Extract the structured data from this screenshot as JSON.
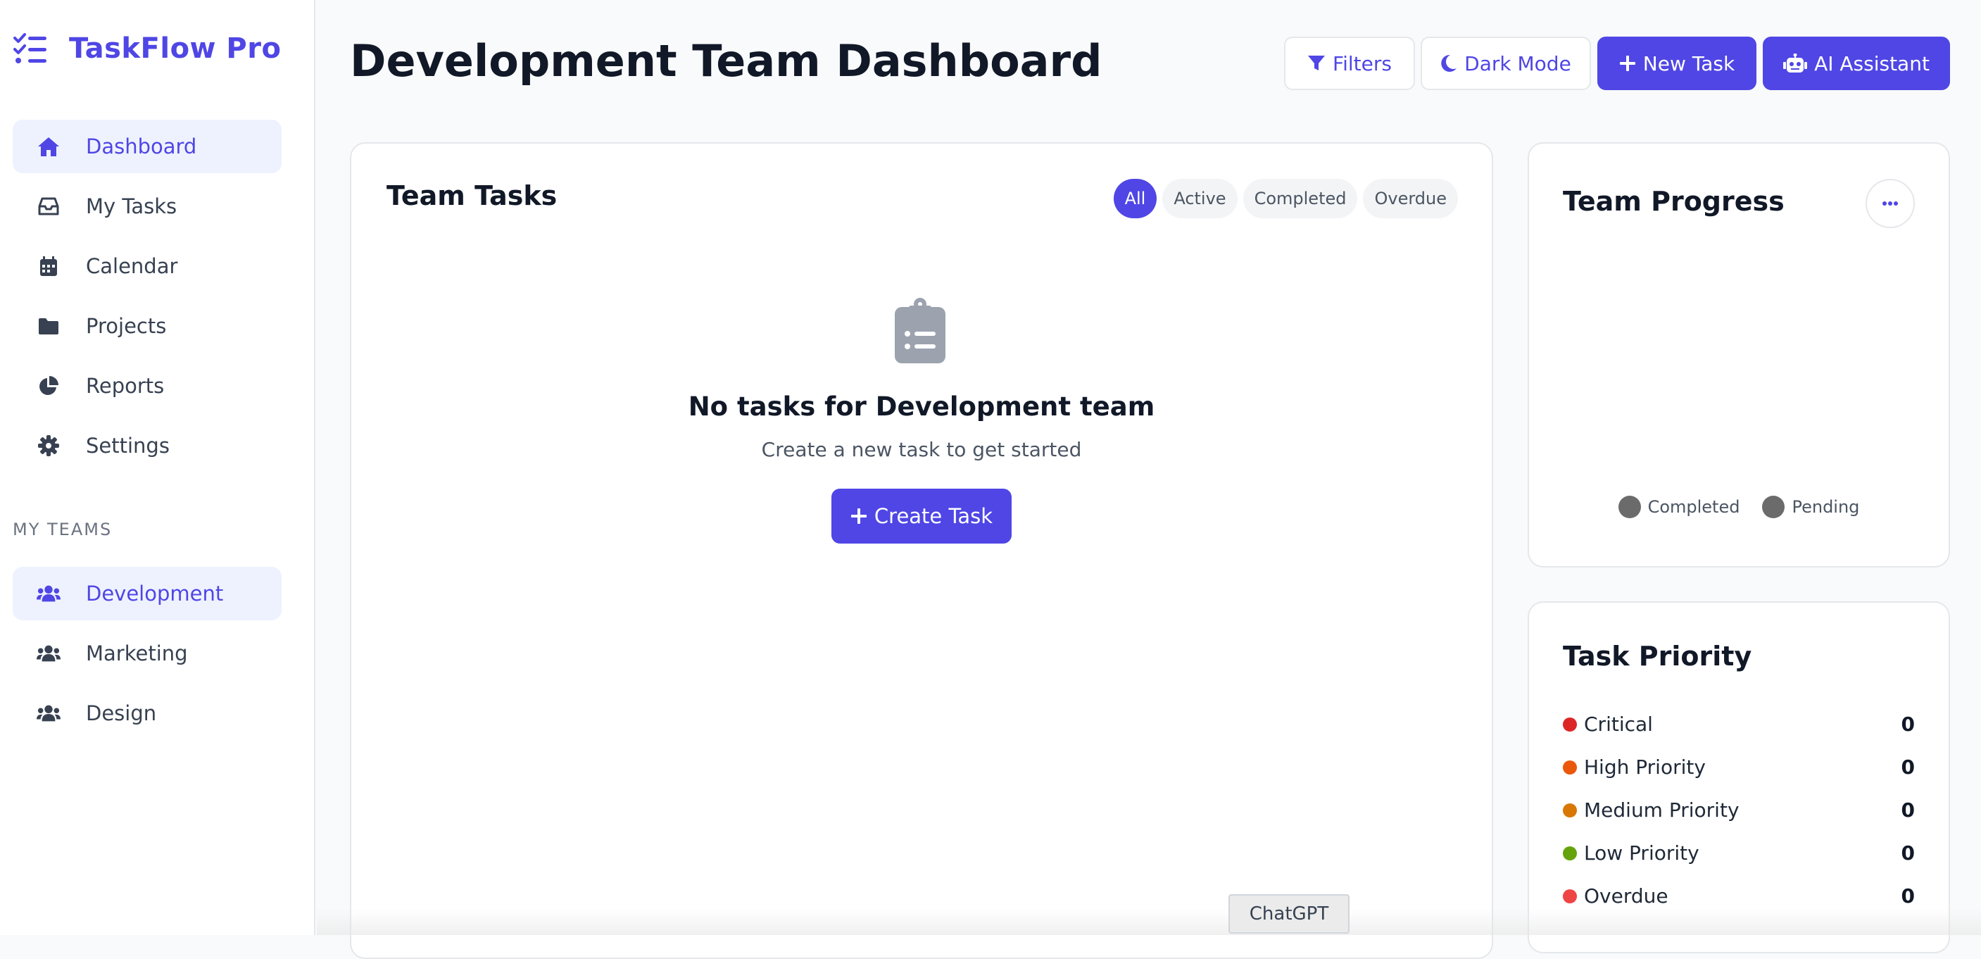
{
  "app": {
    "name": "TaskFlow Pro",
    "accent": "#4f46e5"
  },
  "sidebar": {
    "nav": [
      {
        "label": "Dashboard",
        "icon": "home-icon",
        "active": true
      },
      {
        "label": "My Tasks",
        "icon": "inbox-icon",
        "active": false
      },
      {
        "label": "Calendar",
        "icon": "calendar-icon",
        "active": false
      },
      {
        "label": "Projects",
        "icon": "folder-icon",
        "active": false
      },
      {
        "label": "Reports",
        "icon": "pie-chart-icon",
        "active": false
      },
      {
        "label": "Settings",
        "icon": "gear-icon",
        "active": false
      }
    ],
    "teams_heading": "MY TEAMS",
    "teams": [
      {
        "label": "Development",
        "icon": "users-icon",
        "active": true
      },
      {
        "label": "Marketing",
        "icon": "users-icon",
        "active": false
      },
      {
        "label": "Design",
        "icon": "users-icon",
        "active": false
      }
    ]
  },
  "header": {
    "title": "Development Team Dashboard",
    "buttons": {
      "filters": "Filters",
      "dark_mode": "Dark Mode",
      "new_task": "New Task",
      "ai_assistant": "AI Assistant"
    }
  },
  "team_tasks": {
    "title": "Team Tasks",
    "tabs": [
      "All",
      "Active",
      "Completed",
      "Overdue"
    ],
    "active_tab": "All",
    "empty_title": "No tasks for Development team",
    "empty_subtitle": "Create a new task to get started",
    "create_button": "Create Task"
  },
  "team_progress": {
    "title": "Team Progress",
    "legend": [
      "Completed",
      "Pending"
    ]
  },
  "task_priority": {
    "title": "Task Priority",
    "rows": [
      {
        "label": "Critical",
        "value": "0",
        "color": "#dc2626"
      },
      {
        "label": "High Priority",
        "value": "0",
        "color": "#ea580c"
      },
      {
        "label": "Medium Priority",
        "value": "0",
        "color": "#d97706"
      },
      {
        "label": "Low Priority",
        "value": "0",
        "color": "#65a30d"
      },
      {
        "label": "Overdue",
        "value": "0",
        "color": "#ef4444"
      }
    ]
  },
  "overlay": {
    "chatgpt_label": "ChatGPT"
  }
}
